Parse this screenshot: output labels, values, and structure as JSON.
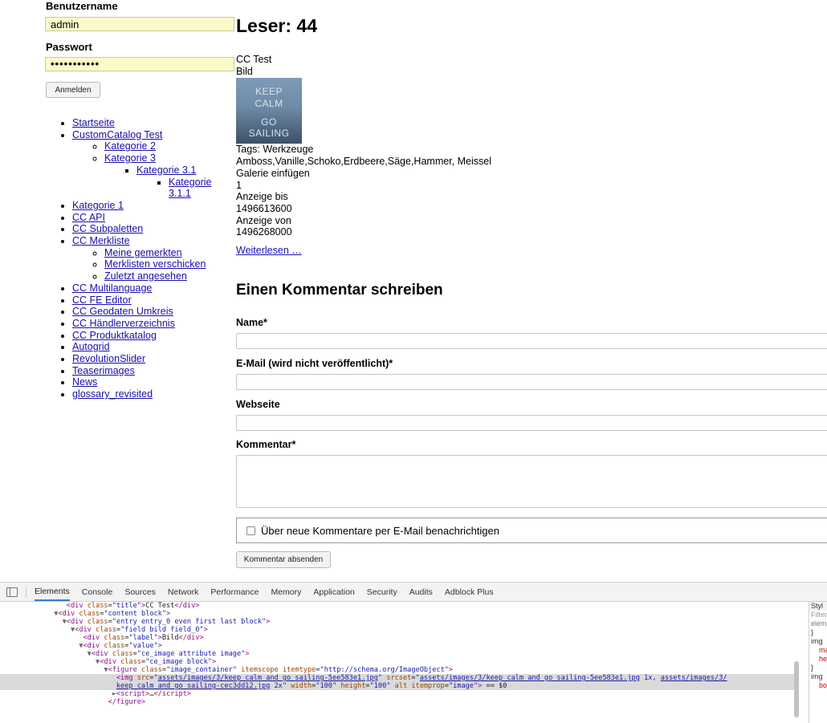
{
  "login": {
    "username_label": "Benutzername",
    "username_value": "admin",
    "password_label": "Passwort",
    "password_value": "•••••••••••",
    "submit_label": "Anmelden"
  },
  "nav": {
    "items": [
      "Startseite",
      "CustomCatalog Test",
      "Kategorie 2",
      "Kategorie 3",
      "Kategorie 3.1",
      "Kategorie 3.1.1",
      "Kategorie 1",
      "CC API",
      "CC Subpaletten",
      "CC Merkliste",
      "Meine gemerkten",
      "Merklisten verschicken",
      "Zuletzt angesehen",
      "CC Multilanguage",
      "CC FE Editor",
      "CC Geodaten Umkreis",
      "CC Händlerverzeichnis",
      "CC Produktkatalog",
      "Autogrid",
      "RevolutionSlider",
      "Teaserimages",
      "News",
      "glossary_revisited"
    ]
  },
  "article": {
    "page_title": "Leser: 44",
    "entry_title": "CC Test",
    "image_label": "Bild",
    "image_text": [
      "KEEP",
      "CALM",
      "GO",
      "SAILING"
    ],
    "tags_line": "Tags: Werkzeuge",
    "tags_values": "Amboss,Vanille,Schoko,Erdbeere,Säge,Hammer, Meissel",
    "gallery_label": "Galerie einfügen",
    "gallery_value": "1",
    "display_until_label": "Anzeige bis",
    "display_until_value": "1496613600",
    "display_from_label": "Anzeige von",
    "display_from_value": "1496268000",
    "read_more": "Weiterlesen …"
  },
  "comment_form": {
    "heading": "Einen Kommentar schreiben",
    "name_label": "Name*",
    "email_label": "E-Mail (wird nicht veröffentlicht)*",
    "website_label": "Webseite",
    "comment_label": "Kommentar*",
    "notify_label": "Über neue Kommentare per E-Mail benachrichtigen",
    "submit_label": "Kommentar absenden"
  },
  "devtools": {
    "tabs": [
      "Elements",
      "Console",
      "Sources",
      "Network",
      "Performance",
      "Memory",
      "Application",
      "Security",
      "Audits",
      "Adblock Plus"
    ],
    "active_tab": "Elements",
    "styles_lines": [
      "Styl",
      "Filter",
      "elem",
      "}",
      "img",
      "ma",
      "he",
      "}",
      "img",
      "bo"
    ]
  },
  "colors": {
    "autofill_bg": "#fafbc8",
    "link": "#1a0dab",
    "devtools_tag": "#881280",
    "devtools_attr": "#994500",
    "devtools_value": "#1a1aa6",
    "selected_row": "#dadada"
  }
}
